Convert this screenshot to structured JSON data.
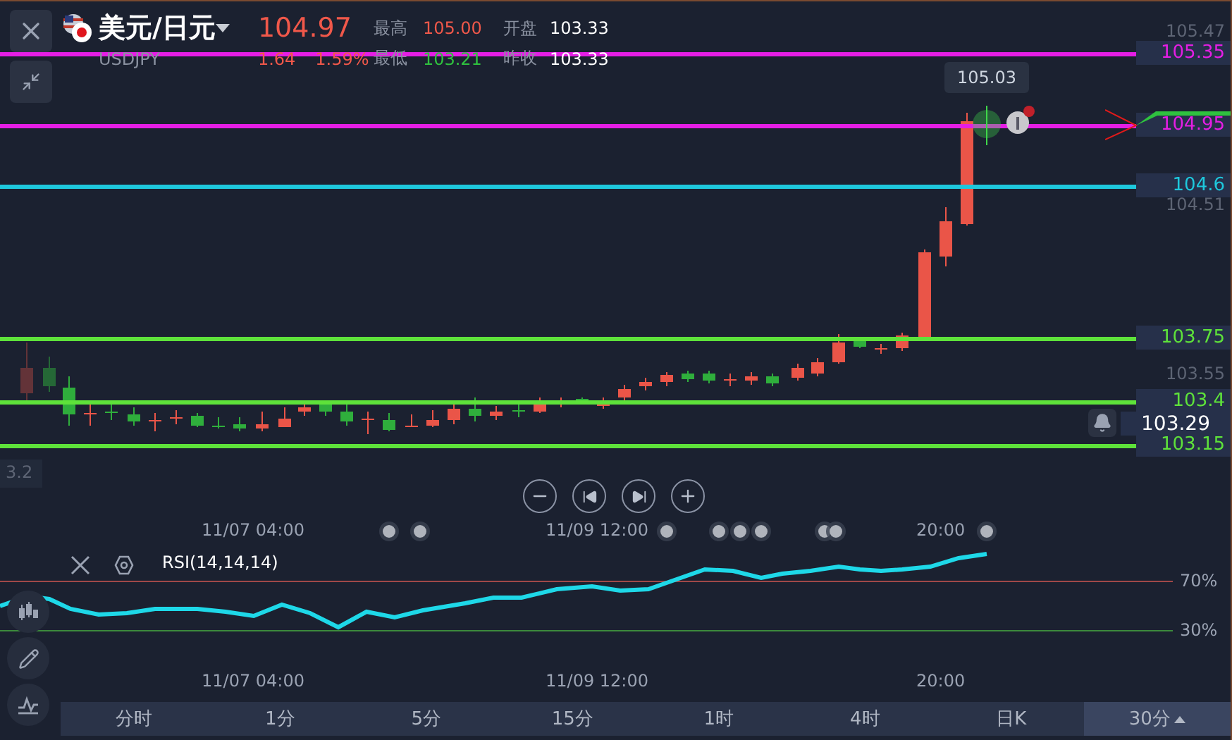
{
  "header": {
    "pair": "美元/日元",
    "symbol": "USDJPY",
    "price": "104.97",
    "change": "1.64",
    "change_pct": "1.59%",
    "stats": [
      {
        "label": "最高",
        "value": "105.00",
        "kind": "up"
      },
      {
        "label": "开盘",
        "value": "103.33",
        "kind": "neutral"
      },
      {
        "label": "最低",
        "value": "103.21",
        "kind": "down"
      },
      {
        "label": "昨收",
        "value": "103.33",
        "kind": "neutral"
      }
    ]
  },
  "price_lines": [
    {
      "label": "105.35",
      "color": "#e51ee5"
    },
    {
      "label": "104.95",
      "color": "#e51ee5"
    },
    {
      "label": "104.6",
      "color": "#1ec8dc"
    },
    {
      "label": "103.75",
      "color": "#5ee23a"
    },
    {
      "label": "103.4",
      "color": "#5ee23a"
    },
    {
      "label": "103.15",
      "color": "#5ee23a"
    }
  ],
  "axis_labels": [
    "105.47",
    "104.51",
    "103.55"
  ],
  "left_axis_label": "3.2",
  "current_price": "103.29",
  "tooltip": "105.03",
  "time_labels": [
    "11/07 04:00",
    "11/09 12:00",
    "20:00"
  ],
  "rsi": {
    "title": "RSI(14,14,14)",
    "levels": [
      "70%",
      "30%"
    ],
    "time_labels": [
      "11/07 04:00",
      "11/09 12:00",
      "20:00"
    ]
  },
  "periods": [
    {
      "label": "分时",
      "selected": false
    },
    {
      "label": "1分",
      "selected": false
    },
    {
      "label": "5分",
      "selected": false
    },
    {
      "label": "15分",
      "selected": false
    },
    {
      "label": "1时",
      "selected": false
    },
    {
      "label": "4时",
      "selected": false
    },
    {
      "label": "日K",
      "selected": false
    },
    {
      "label": "30分",
      "selected": true
    }
  ]
}
